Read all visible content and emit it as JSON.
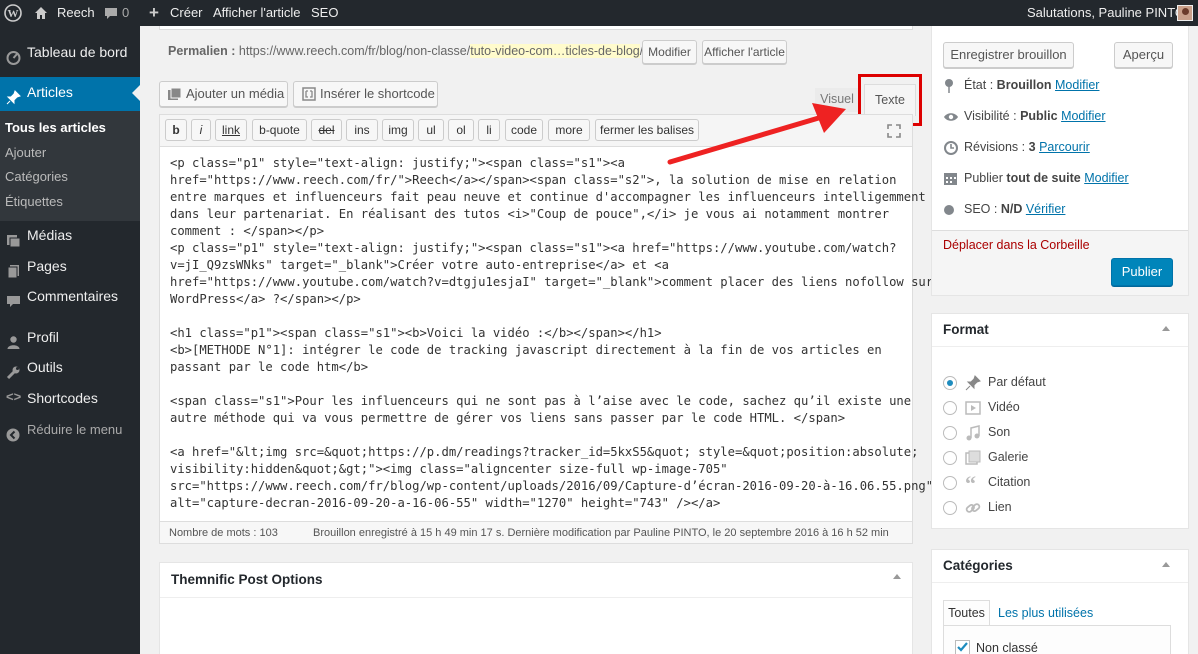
{
  "admin_bar": {
    "site": "Reech",
    "comments": "0",
    "create": "Créer",
    "view_post": "Afficher l'article",
    "seo": "SEO",
    "greeting": "Salutations, Pauline PINTO"
  },
  "menu": {
    "dashboard": "Tableau de bord",
    "articles": "Articles",
    "sub": [
      "Tous les articles",
      "Ajouter",
      "Catégories",
      "Étiquettes"
    ],
    "media": "Médias",
    "pages": "Pages",
    "comments": "Commentaires",
    "profile": "Profil",
    "tools": "Outils",
    "shortcodes": "Shortcodes",
    "collapse": "Réduire le menu"
  },
  "permalink": {
    "label": "Permalien :",
    "base": "https://www.reech.com/fr/blog/non-classe/",
    "slug": "tuto-video-com…ticles-de-blog",
    "end": "/",
    "modify": "Modifier",
    "view": "Afficher l'article"
  },
  "media_buttons": {
    "add_media": "Ajouter un média",
    "insert_shortcode": "Insérer le shortcode"
  },
  "editor_tabs": {
    "visual": "Visuel",
    "text": "Texte"
  },
  "quicktags": [
    "b",
    "i",
    "link",
    "b-quote",
    "del",
    "ins",
    "img",
    "ul",
    "ol",
    "li",
    "code",
    "more",
    "fermer les balises"
  ],
  "code_lines": [
    "<p class=\"p1\" style=\"text-align: justify;\"><span class=\"s1\"><a",
    "href=\"https://www.reech.com/fr/\">Reech</a></span><span class=\"s2\">, la solution de mise en relation",
    "entre marques et influenceurs fait peau neuve et continue d'accompagner les influenceurs intelligemment",
    "dans leur partenariat. En réalisant des tutos <i>\"Coup de pouce\",</i> je vous ai notamment montrer",
    "comment : </span></p>",
    "<p class=\"p1\" style=\"text-align: justify;\"><span class=\"s1\"><a href=\"https://www.youtube.com/watch?",
    "v=jI_Q9zsWNks\" target=\"_blank\">Créer votre auto-entreprise</a> et <a",
    "href=\"https://www.youtube.com/watch?v=dtgju1esjaI\" target=\"_blank\">comment placer des liens nofollow sur",
    "WordPress</a> ?</span></p>",
    "",
    "<h1 class=\"p1\"><span class=\"s1\"><b>Voici la vidéo :</b></span></h1>",
    "<b>[METHODE N°1]: intégrer le code de tracking javascript directement à la fin de vos articles en",
    "passant par le code htm</b>",
    "",
    "<span class=\"s1\">Pour les influenceurs qui ne sont pas à l’aise avec le code, sachez qu’il existe une",
    "autre méthode qui va vous permettre de gérer vos liens sans passer par le code HTML. </span>",
    "",
    "<a href=\"&lt;img src=&quot;https://p.dm/readings?tracker_id=5kxS5&quot; style=&quot;position:absolute;",
    "visibility:hidden&quot;&gt;\"><img class=\"aligncenter size-full wp-image-705\"",
    "src=\"https://www.reech.com/fr/blog/wp-content/uploads/2016/09/Capture-d’écran-2016-09-20-à-16.06.55.png\"",
    "alt=\"capture-decran-2016-09-20-a-16-06-55\" width=\"1270\" height=\"743\" /></a>"
  ],
  "status_bar": {
    "word_count": "Nombre de mots : 103",
    "saved": "Brouillon enregistré à 15 h 49 min 17 s. Dernière modification par Pauline PINTO, le 20 septembre 2016 à 16 h 52 min"
  },
  "themnific": {
    "title": "Themnific Post Options"
  },
  "publish": {
    "save_draft": "Enregistrer brouillon",
    "preview": "Aperçu",
    "status_label": "État :",
    "status_value": "Brouillon",
    "visibility_label": "Visibilité :",
    "visibility_value": "Public",
    "revisions_label": "Révisions :",
    "revisions_value": "3",
    "browse": "Parcourir",
    "publish_label": "Publier",
    "publish_value": "tout de suite",
    "seo_label": "SEO :",
    "seo_value": "N/D",
    "verify": "Vérifier",
    "modify": "Modifier",
    "trash": "Déplacer dans la Corbeille",
    "publish_button": "Publier"
  },
  "format": {
    "title": "Format",
    "options": [
      "Par défaut",
      "Vidéo",
      "Son",
      "Galerie",
      "Citation",
      "Lien"
    ],
    "selected": "Par défaut"
  },
  "categories": {
    "title": "Catégories",
    "tab_all": "Toutes",
    "tab_popular": "Les plus utilisées",
    "item": "Non classé"
  },
  "colors": {
    "adminbar": "#23282d",
    "accent": "#0073aa",
    "highlight": "#dd0000",
    "publish": "#0085ba"
  }
}
